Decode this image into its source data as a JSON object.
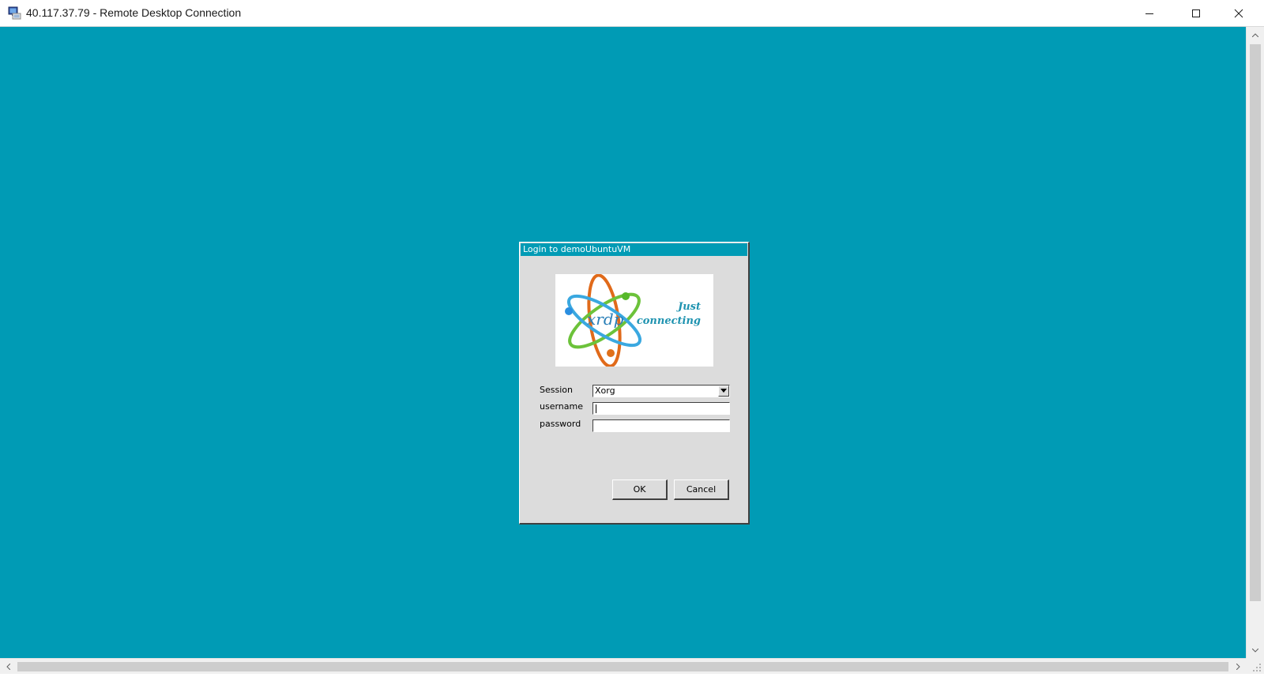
{
  "window": {
    "title": "40.117.37.79 - Remote Desktop Connection",
    "app_icon": "remote-desktop-icon",
    "controls": [
      "minimize-icon",
      "maximize-icon",
      "close-icon"
    ]
  },
  "remote_desktop": {
    "background_color": "#009bb5"
  },
  "login_dialog": {
    "title": "Login to demoUbuntuVM",
    "logo": {
      "brand": "xrdp",
      "tagline_line1": "Just",
      "tagline_line2": "connecting"
    },
    "fields": {
      "session_label": "Session",
      "session_value": "Xorg",
      "username_label": "username",
      "username_value": "",
      "password_label": "password",
      "password_value": ""
    },
    "buttons": {
      "ok_label": "OK",
      "cancel_label": "Cancel"
    }
  },
  "colors": {
    "accent": "#009bb5",
    "dialog_bg": "#dcdcdc"
  }
}
